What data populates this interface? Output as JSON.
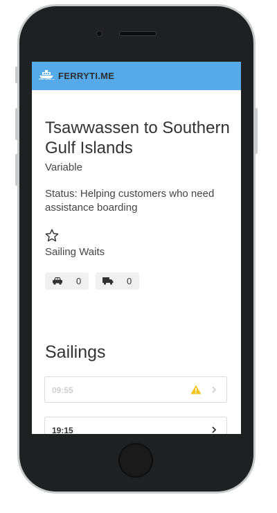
{
  "app": {
    "brand": "FERRYTI.ME",
    "brand_color": "#56aae9"
  },
  "route": {
    "title": "Tsawwassen to Southern Gulf Islands",
    "subtitle": "Variable",
    "status": "Status: Helping customers who need assistance boarding"
  },
  "waits": {
    "label": "Sailing Waits",
    "favorite_icon": "star-outline-icon",
    "car": {
      "icon": "car-icon",
      "count": "0"
    },
    "truck": {
      "icon": "truck-icon",
      "count": "0"
    }
  },
  "sailings": {
    "title": "Sailings",
    "items": [
      {
        "time": "09:55",
        "past": true,
        "warning": true,
        "warning_color": "#f3c21b"
      },
      {
        "time": "19:15",
        "past": false,
        "warning": false
      }
    ]
  }
}
